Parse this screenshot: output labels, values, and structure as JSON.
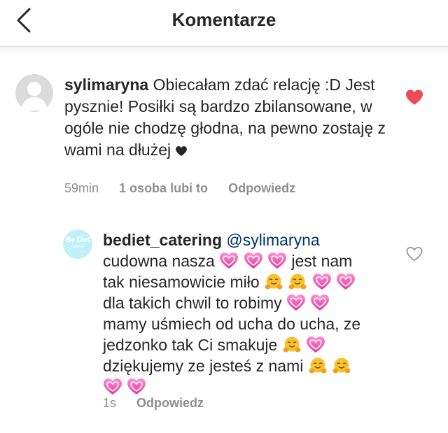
{
  "header": {
    "title": "Komentarze",
    "back_icon": "chevron-left-icon"
  },
  "comments": [
    {
      "username": "sylimaryna",
      "text": "Obiecałam zdać relację :D Jest pysznie! Posiłki są bardzo zbilansowane, w ogóle nie chodzę głodna, na pewno zostaję z wami na dłużej",
      "trailing_emoji": "black-heart",
      "time": "59min",
      "likes": "1 osoba lubi to",
      "reply": "Odpowiedz",
      "liked": true,
      "like_color": "#ed4956"
    },
    {
      "username": "bediet_catering",
      "avatar_text": "Be Diet",
      "avatar_sub": "catering",
      "mention": "@sylimaryna",
      "lines": [
        "cudowna nasza",
        "jest nam",
        "tak niesamowicie miło",
        "dla takich chwil to robimy",
        "mamy uśmiech od ucha do ucha, ze",
        "jedzonko tak Ci smakuje",
        "dziękujemy ze jesteś z nami"
      ],
      "time": "1s",
      "reply": "Odpowiedz",
      "liked": false
    }
  ],
  "colors": {
    "heart_emoji": "#ee4fa3",
    "hug_emoji": "#f8b62a",
    "meta_text": "#8e8e8e"
  }
}
